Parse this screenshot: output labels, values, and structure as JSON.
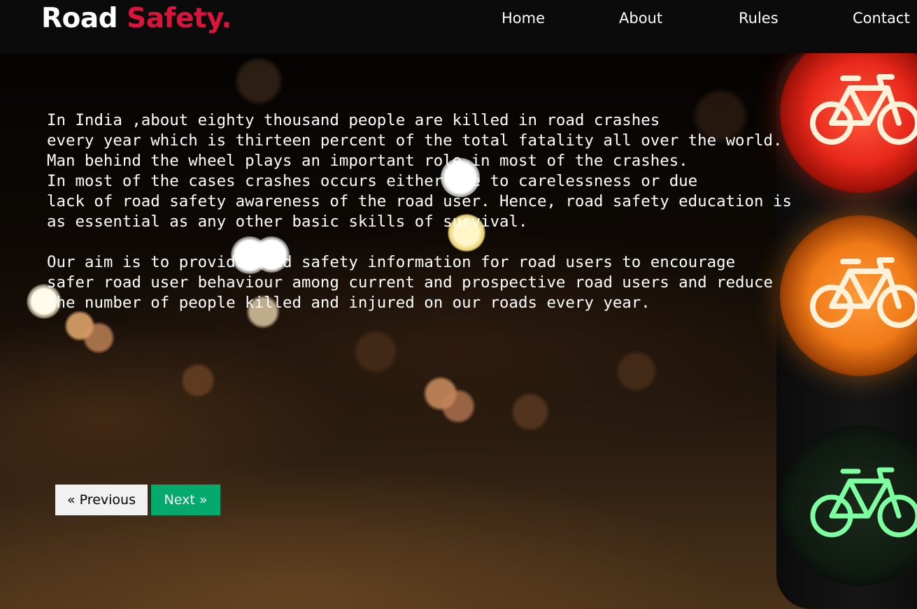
{
  "brand": {
    "name_part1": "Road",
    "name_part2": "Safety.",
    "accent_color": "#dc143c"
  },
  "nav": {
    "items": [
      {
        "label": "Home"
      },
      {
        "label": "About"
      },
      {
        "label": "Rules"
      },
      {
        "label": "Contact"
      }
    ]
  },
  "main": {
    "paragraph1": [
      "In India ,about eighty thousand people are killed in road crashes",
      "every year which is thirteen percent of the total fatality all over the world.",
      "Man behind the wheel plays an important role in most of the crashes.",
      "In most of the cases crashes occurs either due to carelessness or due",
      "lack of road safety awareness of the road user. Hence, road safety education is",
      "as essential as any other basic skills of survival."
    ],
    "paragraph2": [
      "Our aim is to provide road safety information for road users to encourage",
      "safer road user behaviour among current and prospective road users and reduce",
      "the number of people killed and injured on our roads every year."
    ]
  },
  "pagination": {
    "previous_label": "« Previous",
    "next_label": "Next »",
    "next_color": "#04aa6d"
  },
  "background": {
    "icons": [
      "red-bicycle-signal-icon",
      "amber-bicycle-signal-icon",
      "green-bicycle-signal-icon"
    ]
  }
}
